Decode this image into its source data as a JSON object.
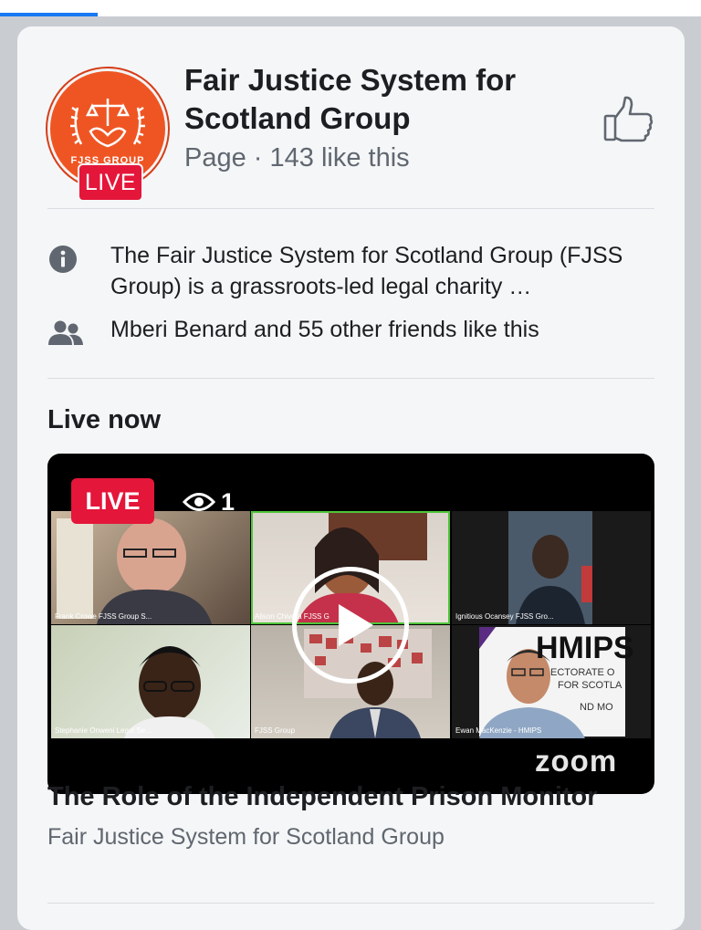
{
  "page": {
    "title": "Fair Justice System for Scotland Group",
    "meta": "Page · 143 like this",
    "avatar_text": "FJSS GROUP",
    "avatar_live_label": "LIVE",
    "about_text": "The Fair Justice System for Scotland Group (FJSS Group) is a grassroots-led legal charity …",
    "friends_text": "Mberi Benard and 55 other friends like this"
  },
  "live_section": {
    "heading": "Live now",
    "live_badge": "LIVE",
    "viewer_count": "1",
    "zoom_logo": "zoom",
    "participants": [
      {
        "name": "Frank Crowe FJSS Group S..."
      },
      {
        "name": "Alison Chivera FJSS G"
      },
      {
        "name": "Ignitious Ocansey FJSS Gro..."
      },
      {
        "name": "Stephanie Onweni Legal Se..."
      },
      {
        "name": "FJSS Group"
      },
      {
        "name": "Ewan MacKenzie - HMIPS"
      }
    ],
    "hmips_sign": "HMIPS",
    "hmips_sub1": "ECTORATE O",
    "hmips_sub2": "FOR SCOTLA",
    "hmips_sub3": "ND MO",
    "video_title": "The Role of the Independent Prison Monitor",
    "video_subtitle": "Fair Justice System for Scotland Group"
  },
  "colors": {
    "live_red": "#e4163a",
    "brand_orange": "#ef5523",
    "text_primary": "#1c1e21",
    "text_secondary": "#606770",
    "active_speaker": "#4fc43a"
  },
  "icons": {
    "like": "thumbs-up-icon",
    "info": "info-icon",
    "friends": "people-icon",
    "viewers": "eye-icon",
    "play": "play-icon"
  }
}
